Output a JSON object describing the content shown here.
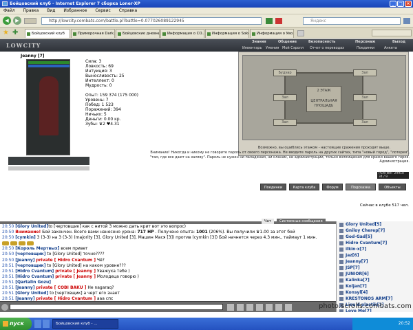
{
  "window": {
    "title": "Бойцовский клуб - Internet Explorer 7 сборка Loner-XP"
  },
  "menu": [
    "Файл",
    "Правка",
    "Вид",
    "Избранное",
    "Сервис",
    "Справка"
  ],
  "address": {
    "url": "http://lowcity.combats.com/battle.pl?battle=0.077026089122945",
    "search_placeholder": "Яндекс"
  },
  "tabs": [
    "Бойцовский клуб",
    "Приморочная Dark...",
    "Бойцовские дневни...",
    "Информация о CO...",
    "Информация о Sokolli...",
    "Информация о Уво..."
  ],
  "game": {
    "logo": "LOWCITY",
    "nav_top": [
      "Знания",
      "Общение",
      "Безопасность",
      "Персонаж",
      "Выход"
    ],
    "nav_bottom": [
      "Инвентарь",
      "Умения",
      "Мой Сэролл",
      "Отчет о переводах",
      "Поединки",
      "Анкета"
    ]
  },
  "character": {
    "name": "Jeanny [7]",
    "hp": "34/176",
    "mana": "186/176"
  },
  "stats": [
    "Сила: 3",
    "Ловкость: 69",
    "Интуиция: 3",
    "Выносливость: 25",
    "Интеллект: 0",
    "Мудрость: 0",
    "",
    "Опыт: 159 374 (175 000)",
    "Уровень: 7",
    "Побед: 1 523",
    "Поражений: 394",
    "Ничьих: 5",
    "Деньги: 0.00 кр.",
    "Зубы: ♛2 ♥4.31"
  ],
  "map": {
    "rooms": [
      "Будуар",
      "Зал",
      "Зал",
      "Зал",
      "Зал",
      "Зал"
    ],
    "center_top": "2 ЭТАЖ",
    "center": "ЦЕНТРАЛЬНАЯ ПЛОЩАДЬ",
    "caption": "Возможно, вы ошиблись этажом - настоящие сражения проходят выше."
  },
  "buttons": [
    "Поединки",
    "Карта клуба",
    "Форум",
    "Подсказка",
    "Объекты"
  ],
  "warning": [
    "Внимание! Никогда и никому не говорите пароль от своего персонажа. Не вводите пароль на других сайтах, типа \"новый город\", \"лотерея\",",
    "\"там, где все дают на халяву\". Пароль не нужен ни паладинам, ни кланам, ни администрации, только взломщикам для кражи вашего героя.",
    "Администрация."
  ],
  "online": "Сейчас в клубе 517 чел.",
  "counter": "РЕЙТИНГ 29910 34 / 9",
  "chat_tabs": [
    "Чат",
    "Системные сообщения"
  ],
  "chat": [
    {
      "t": "20:50",
      "parts": [
        [
          "n",
          "[Glory United]"
        ],
        [
          "",
          "to [чертовщик] как с нитой 3 можно дать крит вот это вопрос)"
        ]
      ]
    },
    {
      "t": "20:50",
      "parts": [
        [
          "p",
          "Внимание!"
        ],
        [
          "",
          " Бой закончен. Всего вами нанесено урона: "
        ],
        [
          "b",
          "717 HP"
        ],
        [
          "",
          " . Получено опыта: "
        ],
        [
          "b",
          "1001"
        ],
        [
          "",
          " (206%). Вы получили ♛1.00 за этот бой"
        ]
      ]
    },
    {
      "t": "20:50",
      "parts": [
        [
          "n",
          "[cymkin]"
        ],
        [
          "",
          " 3 (3-3) на 3 (3-3) (majority [3], Glory United [3], Машин Мася [3]) против (cymkin [3]) Бой начнется через 4.3 мин., таймаут 1 мин."
        ]
      ]
    },
    {
      "t": "",
      "parts": [
        [
          "i",
          ""
        ],
        [
          "i",
          ""
        ],
        [
          "i",
          ""
        ],
        [
          "i",
          ""
        ]
      ]
    },
    {
      "t": "20:50",
      "parts": [
        [
          "n",
          "[Король Мертвых]"
        ],
        [
          "",
          " всем привет"
        ]
      ]
    },
    {
      "t": "20:50",
      "parts": [
        [
          "n",
          "[чертовщик]"
        ],
        [
          "",
          " to [Glory United] точно????"
        ]
      ]
    },
    {
      "t": "20:50",
      "parts": [
        [
          "n",
          "[Jeanny]"
        ],
        [
          " ",
          " "
        ],
        [
          "p",
          "private [ Hidro Cvantum ]"
        ],
        [
          "",
          " Чё?"
        ]
      ]
    },
    {
      "t": "20:51",
      "parts": [
        [
          "n",
          "[чертовщик]"
        ],
        [
          "",
          " to [Glory United] на каком уровне???"
        ]
      ]
    },
    {
      "t": "20:51",
      "parts": [
        [
          "n",
          "[Hidro Cvantum]"
        ],
        [
          "",
          " "
        ],
        [
          "p",
          "private [ Jeanny ]"
        ],
        [
          "",
          " Уважуха тебе )"
        ]
      ]
    },
    {
      "t": "20:51",
      "parts": [
        [
          "n",
          "[Hidro Cvantum]"
        ],
        [
          "",
          " "
        ],
        [
          "p",
          "private [ Jeanny ]"
        ],
        [
          "",
          " Молодеца говорю )"
        ]
      ]
    },
    {
      "t": "20:51",
      "parts": [
        [
          "n",
          "[Qartalin Gozu]"
        ],
        [
          "",
          " "
        ]
      ]
    },
    {
      "t": "20:51",
      "parts": [
        [
          "n",
          "[Jeanny]"
        ],
        [
          "",
          " "
        ],
        [
          "p",
          "private [ COBI BAKU ]"
        ],
        [
          "",
          " Не nagaraq?"
        ]
      ]
    },
    {
      "t": "20:51",
      "parts": [
        [
          "n",
          "[Glory United]"
        ],
        [
          "",
          " to [чертовщик] а черт его знает"
        ]
      ]
    },
    {
      "t": "20:51",
      "parts": [
        [
          "n",
          "[Jeanny]"
        ],
        [
          "",
          " "
        ],
        [
          "p",
          "private [ Hidro Cvantum ]"
        ],
        [
          "",
          " ааа спс"
        ]
      ]
    },
    {
      "t": "20:51",
      "parts": [
        [
          "n",
          "[Jeanny]"
        ],
        [
          "",
          " "
        ],
        [
          "p",
          "private [ Hidro Cvantum ]"
        ],
        [
          "",
          " ой...тфу .. молодца*"
        ]
      ]
    }
  ],
  "users": [
    "Glory United[5]",
    "Gniloy Cherep[7]",
    "God-Gad[5]",
    "Hidro Cvantum[7]",
    "ilkin-x[7]",
    "Jaz[6]",
    "Jeanny[7]",
    "JSP[7]",
    "JUNIOR[6]",
    "Kalinka[7]",
    "Koljan[7]",
    "Konsyl[4]",
    "KRESTONOS ARM[7]",
    "Liquid plastik[7]",
    "Love Me[7]"
  ],
  "taskbar": {
    "start": "пуск",
    "task": "Бойцовский клуб - ...",
    "time": "20:52"
  },
  "watermark": "photo.scrolls.combats.com"
}
